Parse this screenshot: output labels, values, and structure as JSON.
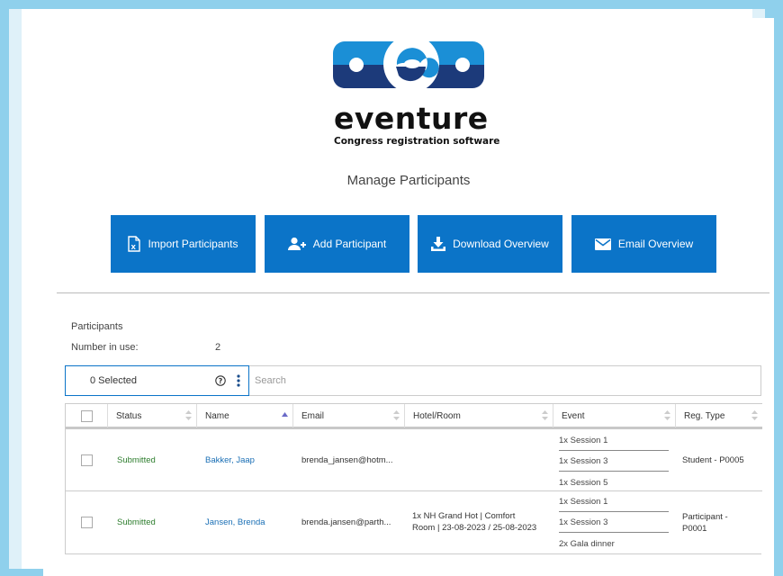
{
  "brand": {
    "name": "eventure",
    "tagline": "Congress registration software",
    "colors": {
      "light": "#1b8fd6",
      "dark": "#1c3a7a"
    }
  },
  "page": {
    "title": "Manage Participants"
  },
  "actions": [
    {
      "label": "Import Participants",
      "icon": "excel-file-icon"
    },
    {
      "label": "Add Participant",
      "icon": "add-user-icon"
    },
    {
      "label": "Download Overview",
      "icon": "download-icon"
    },
    {
      "label": "Email Overview",
      "icon": "envelope-icon"
    }
  ],
  "participants": {
    "section_title": "Participants",
    "number_in_use_label": "Number in use:",
    "number_in_use_value": "2",
    "selected_label": "0 Selected",
    "search_placeholder": "Search",
    "columns": [
      "Status",
      "Name",
      "Email",
      "Hotel/Room",
      "Event",
      "Reg. Type"
    ],
    "rows": [
      {
        "status": "Submitted",
        "name": "Bakker, Jaap",
        "email": "brenda_jansen@hotm...",
        "hotel_line1": "",
        "hotel_line2": "",
        "events": [
          "1x Session 1",
          "1x Session 3",
          "1x Session 5"
        ],
        "reg_type_line1": "Student - P0005",
        "reg_type_line2": ""
      },
      {
        "status": "Submitted",
        "name": "Jansen, Brenda",
        "email": "brenda.jansen@parth...",
        "hotel_line1": "1x NH Grand Hot | Comfort",
        "hotel_line2": "Room | 23-08-2023 / 25-08-2023",
        "events": [
          "1x Session 1",
          "1x Session 3",
          "2x Gala dinner"
        ],
        "reg_type_line1": "Participant -",
        "reg_type_line2": "P0001"
      }
    ]
  }
}
